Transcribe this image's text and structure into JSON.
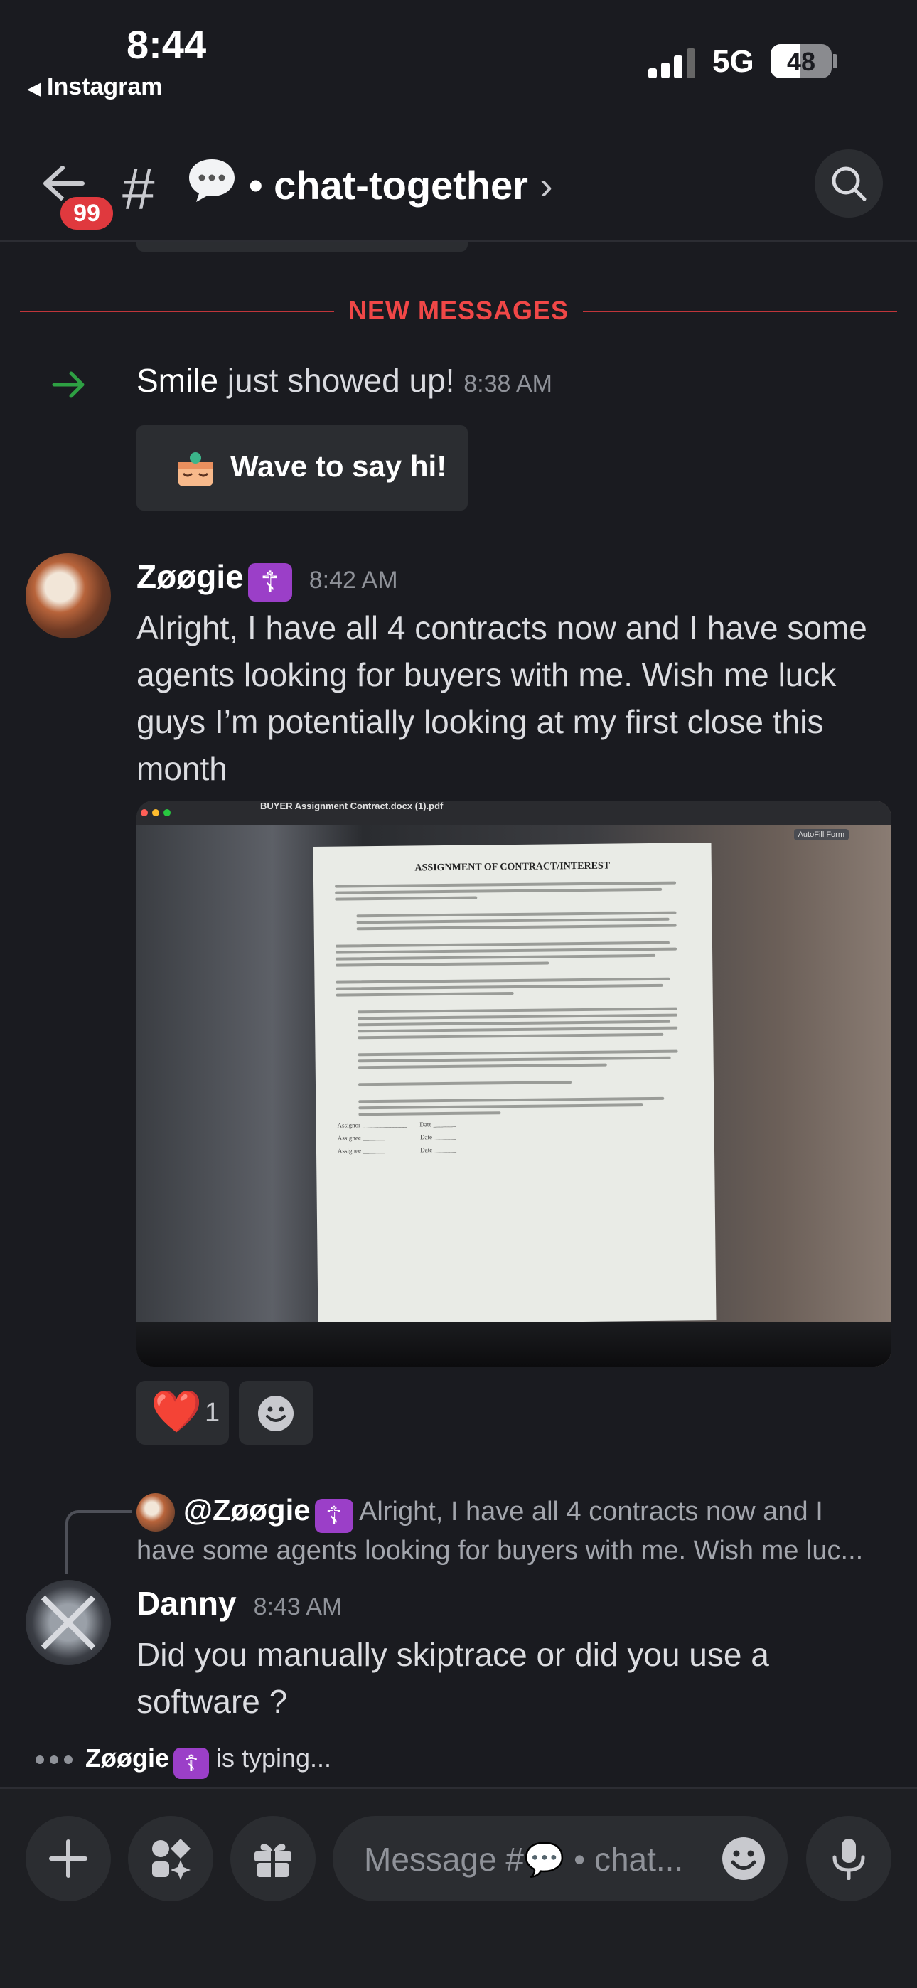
{
  "status_bar": {
    "time": "8:44",
    "back_app": "Instagram",
    "network": "5G",
    "battery": "48",
    "battery_level": 0.48
  },
  "header": {
    "unread_badge": "99",
    "hash": "#",
    "channel_name": "• chat-together",
    "chevron": "›"
  },
  "divider": {
    "label": "NEW MESSAGES"
  },
  "join": {
    "user": "Smile",
    "text": " just showed up! ",
    "time": "8:38 AM",
    "wave_button": "Wave to say hi!"
  },
  "messages": [
    {
      "author": "Zøøgie",
      "tag": "☦",
      "time": "8:42 AM",
      "text": "Alright, I have all 4 contracts now and I have some agents looking for buyers with me. Wish me luck guys I’m potentially looking at my first close this month",
      "attachment": {
        "window_title": "BUYER Assignment Contract.docx (1).pdf",
        "autofill_label": "AutoFill Form",
        "doc_heading": "ASSIGNMENT OF CONTRACT/INTEREST",
        "signature_labels": [
          "Assignor",
          "Assignee",
          "Assignee"
        ],
        "date_label": "Date"
      },
      "reactions": [
        {
          "emoji": "❤️",
          "count": "1"
        }
      ]
    },
    {
      "author": "Danny",
      "time": "8:43 AM",
      "reply_to": {
        "mention": "@Zøøgie",
        "tag": "☦",
        "preview_line1": " Alright, I have all 4 contracts now and I",
        "preview_line2": "have some agents looking for buyers with me. Wish me luc..."
      },
      "text": "Did you manually skiptrace or did you use a software ?"
    }
  ],
  "typing": {
    "user": "Zøøgie",
    "tag": "☦",
    "text": " is typing..."
  },
  "composer": {
    "placeholder": "Message #💬 • chat..."
  },
  "icons": [
    "back-arrow-icon",
    "hash-icon",
    "speech-bubble-icon",
    "search-icon",
    "join-arrow-icon",
    "wave-sticker-icon",
    "heart-icon",
    "add-reaction-icon",
    "plus-icon",
    "apps-icon",
    "gift-icon",
    "emoji-icon",
    "microphone-icon"
  ],
  "colors": {
    "background": "#1a1b20",
    "accent_red": "#f04747",
    "badge_red": "#e0393e",
    "tag_purple": "#9b3fc8",
    "join_green": "#2ea043"
  }
}
